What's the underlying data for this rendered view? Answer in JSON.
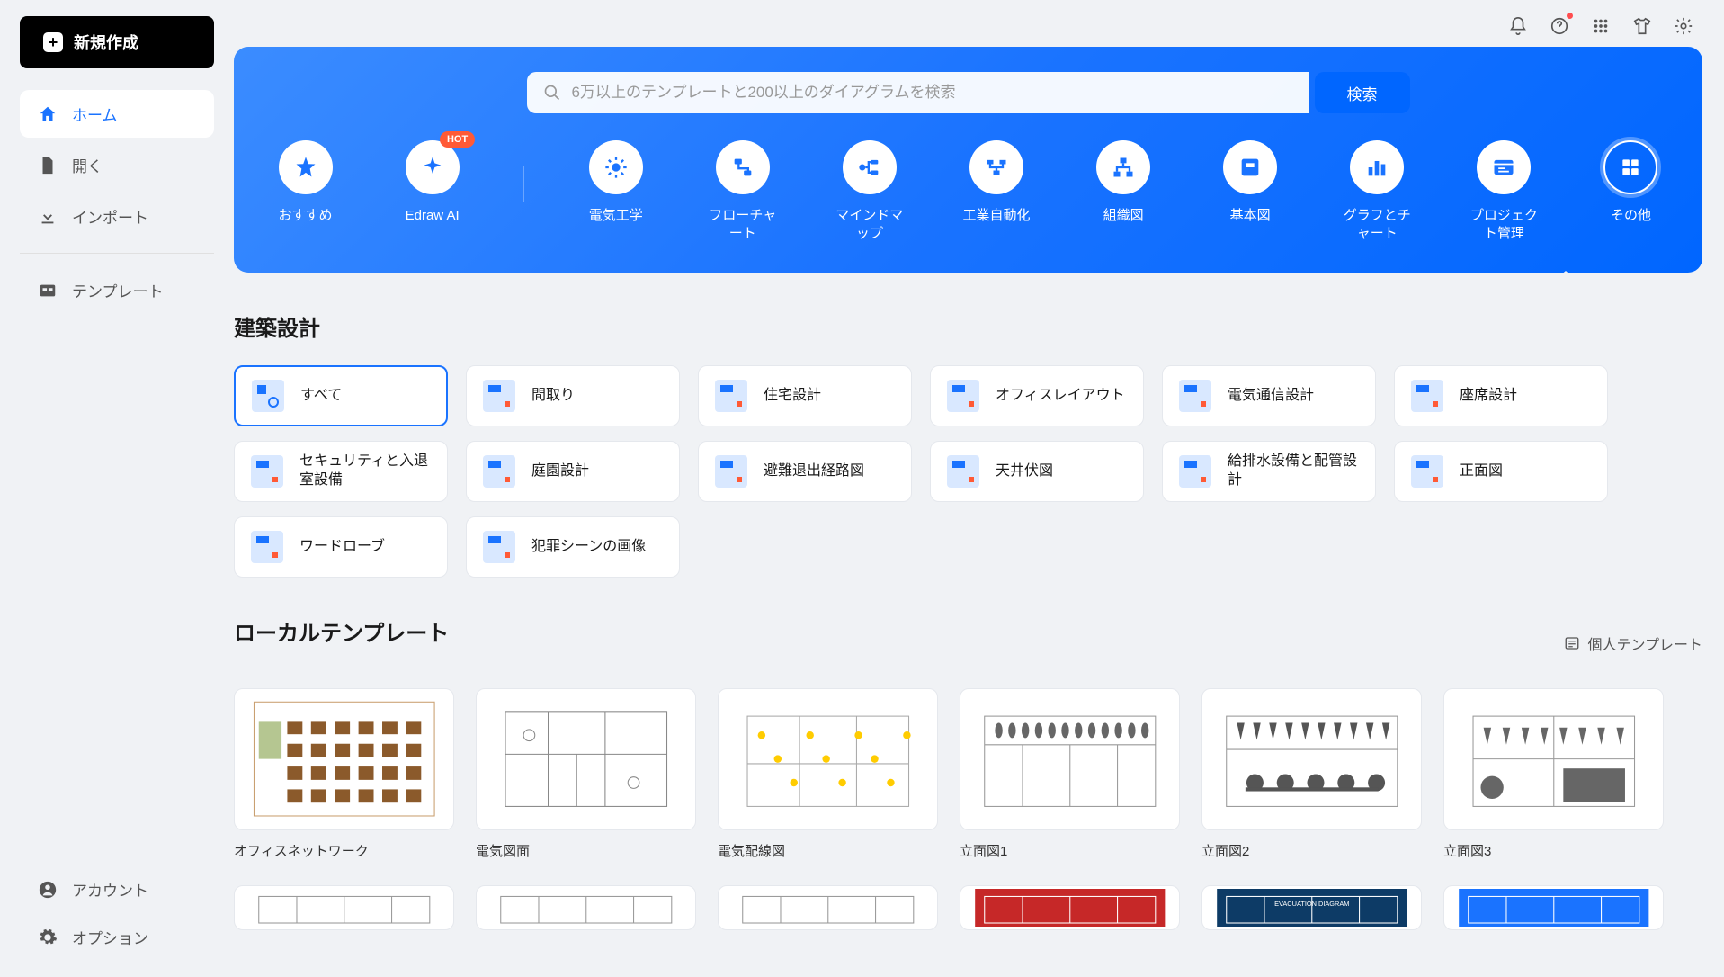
{
  "newButton": "新規作成",
  "sidebar": {
    "items": [
      {
        "label": "ホーム",
        "icon": "home",
        "active": true
      },
      {
        "label": "開く",
        "icon": "file"
      },
      {
        "label": "インポート",
        "icon": "import"
      }
    ],
    "template": "テンプレート",
    "account": "アカウント",
    "options": "オプション"
  },
  "search": {
    "placeholder": "6万以上のテンプレートと200以上のダイアグラムを検索",
    "button": "検索"
  },
  "categories": [
    {
      "label": "おすすめ",
      "icon": "star"
    },
    {
      "label": "Edraw AI",
      "icon": "ai",
      "hot": true
    },
    {
      "label": "電気工学",
      "icon": "gear"
    },
    {
      "label": "フローチャート",
      "icon": "flow"
    },
    {
      "label": "マインドマップ",
      "icon": "mind"
    },
    {
      "label": "工業自動化",
      "icon": "industry"
    },
    {
      "label": "組織図",
      "icon": "org"
    },
    {
      "label": "基本図",
      "icon": "basic"
    },
    {
      "label": "グラフとチャート",
      "icon": "chart"
    },
    {
      "label": "プロジェクト管理",
      "icon": "project"
    },
    {
      "label": "その他",
      "icon": "more",
      "selected": true
    }
  ],
  "hotBadge": "HOT",
  "sectionTitle": "建築設計",
  "filters": [
    {
      "label": "すべて",
      "active": true
    },
    {
      "label": "間取り"
    },
    {
      "label": "住宅設計"
    },
    {
      "label": "オフィスレイアウト"
    },
    {
      "label": "電気通信設計"
    },
    {
      "label": "座席設計"
    },
    {
      "label": "セキュリティと入退室設備"
    },
    {
      "label": "庭園設計"
    },
    {
      "label": "避難退出経路図"
    },
    {
      "label": "天井伏図"
    },
    {
      "label": "給排水設備と配管設計"
    },
    {
      "label": "正面図"
    },
    {
      "label": "ワードローブ"
    },
    {
      "label": "犯罪シーンの画像"
    }
  ],
  "localTitle": "ローカルテンプレート",
  "personalLink": "個人テンプレート",
  "templates": [
    {
      "name": "オフィスネットワーク"
    },
    {
      "name": "電気図面"
    },
    {
      "name": "電気配線図"
    },
    {
      "name": "立面図1"
    },
    {
      "name": "立面図2"
    },
    {
      "name": "立面図3"
    }
  ]
}
